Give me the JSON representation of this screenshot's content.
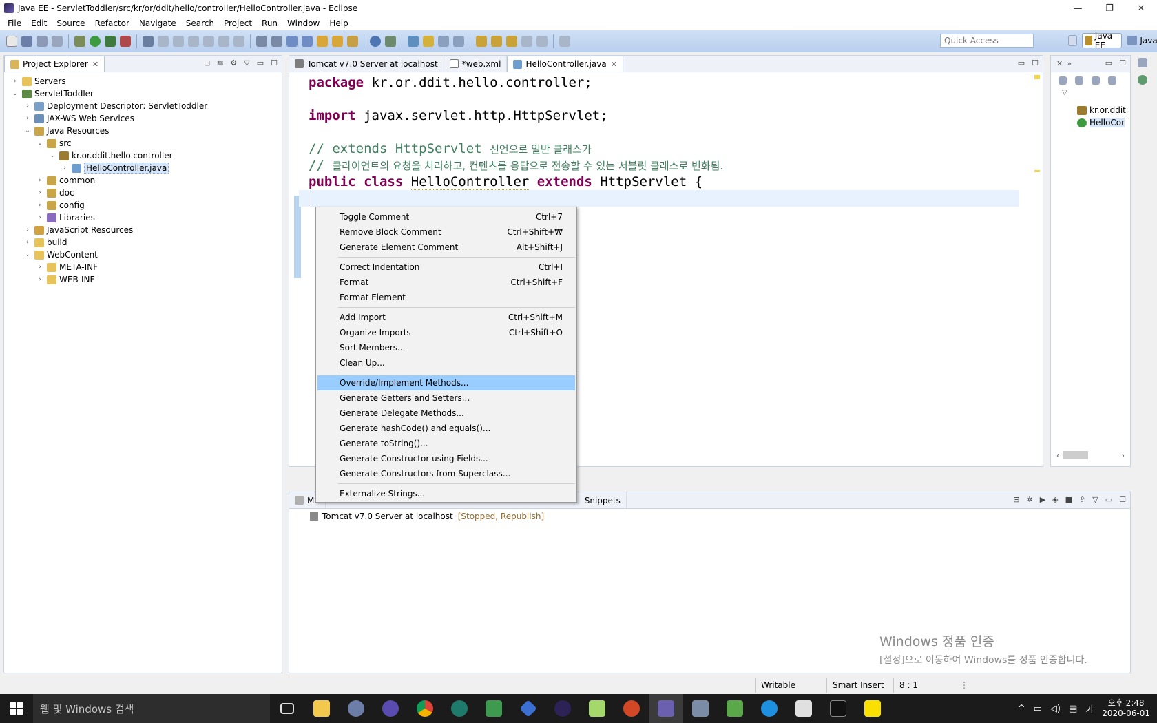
{
  "window": {
    "title": "Java EE - ServletToddler/src/kr/or/ddit/hello/controller/HelloController.java - Eclipse",
    "minimize": "—",
    "restore": "❐",
    "close": "✕"
  },
  "menubar": {
    "items": [
      {
        "label": "File"
      },
      {
        "label": "Edit"
      },
      {
        "label": "Source"
      },
      {
        "label": "Refactor"
      },
      {
        "label": "Navigate"
      },
      {
        "label": "Search"
      },
      {
        "label": "Project"
      },
      {
        "label": "Run"
      },
      {
        "label": "Window"
      },
      {
        "label": "Help"
      }
    ]
  },
  "toolbar": {
    "quick_access_placeholder": "Quick Access",
    "perspectives": [
      {
        "label": "Java EE",
        "active": true
      },
      {
        "label": "Java",
        "active": false
      }
    ]
  },
  "project_explorer": {
    "tab_label": "Project Explorer",
    "tree": [
      {
        "label": "Servers",
        "depth": 0,
        "expander": ">",
        "icon": "folder-icon"
      },
      {
        "label": "ServletToddler",
        "depth": 0,
        "expander": "v",
        "icon": "project-icon"
      },
      {
        "label": "Deployment Descriptor: ServletToddler",
        "depth": 1,
        "expander": ">",
        "icon": "deployment-descriptor-icon"
      },
      {
        "label": "JAX-WS Web Services",
        "depth": 1,
        "expander": ">",
        "icon": "web-services-icon"
      },
      {
        "label": "Java Resources",
        "depth": 1,
        "expander": "v",
        "icon": "java-resources-icon"
      },
      {
        "label": "src",
        "depth": 2,
        "expander": "v",
        "icon": "source-folder-icon"
      },
      {
        "label": "kr.or.ddit.hello.controller",
        "depth": 3,
        "expander": "v",
        "icon": "package-icon"
      },
      {
        "label": "HelloController.java",
        "depth": 4,
        "expander": ">",
        "icon": "java-file-icon",
        "selected": true
      },
      {
        "label": "common",
        "depth": 2,
        "expander": ">",
        "icon": "source-folder-icon"
      },
      {
        "label": "doc",
        "depth": 2,
        "expander": ">",
        "icon": "source-folder-icon"
      },
      {
        "label": "config",
        "depth": 2,
        "expander": ">",
        "icon": "source-folder-icon"
      },
      {
        "label": "Libraries",
        "depth": 2,
        "expander": ">",
        "icon": "library-icon"
      },
      {
        "label": "JavaScript Resources",
        "depth": 1,
        "expander": ">",
        "icon": "javascript-resources-icon"
      },
      {
        "label": "build",
        "depth": 1,
        "expander": ">",
        "icon": "folder-icon"
      },
      {
        "label": "WebContent",
        "depth": 1,
        "expander": "v",
        "icon": "folder-icon"
      },
      {
        "label": "META-INF",
        "depth": 2,
        "expander": ">",
        "icon": "folder-icon"
      },
      {
        "label": "WEB-INF",
        "depth": 2,
        "expander": ">",
        "icon": "folder-icon"
      }
    ]
  },
  "editor": {
    "tabs": [
      {
        "label": "Tomcat v7.0 Server at localhost",
        "active": false
      },
      {
        "label": "*web.xml",
        "active": false
      },
      {
        "label": "HelloController.java",
        "active": true
      }
    ],
    "code": {
      "line1_kw": "package",
      "line1_rest": " kr.or.ddit.hello.controller;",
      "line3_kw": "import",
      "line3_rest": " javax.servlet.http.HttpServlet;",
      "line5": "// extends HttpServlet ",
      "line5_kr": "선언으로 일반 클래스가",
      "line6": "// ",
      "line6_kr": "클라이언트의 요청을 처리하고, 컨텐츠를 응답으로 전송할 수 있는 서블릿 클래스로 변화됨.",
      "line7_kw1": "public",
      "line7_kw2": "class",
      "line7_name": "HelloController",
      "line7_kw3": "extends",
      "line7_rest": " HttpServlet {"
    }
  },
  "outline": {
    "items": [
      {
        "label": "kr.or.ddit"
      },
      {
        "label": "HelloCor"
      }
    ]
  },
  "context_menu": {
    "groups": [
      [
        {
          "label": "Toggle Comment",
          "shortcut": "Ctrl+7"
        },
        {
          "label": "Remove Block Comment",
          "shortcut": "Ctrl+Shift+₩"
        },
        {
          "label": "Generate Element Comment",
          "shortcut": "Alt+Shift+J"
        }
      ],
      [
        {
          "label": "Correct Indentation",
          "shortcut": "Ctrl+I"
        },
        {
          "label": "Format",
          "shortcut": "Ctrl+Shift+F"
        },
        {
          "label": "Format Element",
          "shortcut": ""
        }
      ],
      [
        {
          "label": "Add Import",
          "shortcut": "Ctrl+Shift+M"
        },
        {
          "label": "Organize Imports",
          "shortcut": "Ctrl+Shift+O"
        },
        {
          "label": "Sort Members...",
          "shortcut": ""
        },
        {
          "label": "Clean Up...",
          "shortcut": ""
        }
      ],
      [
        {
          "label": "Override/Implement Methods...",
          "shortcut": "",
          "highlighted": true
        },
        {
          "label": "Generate Getters and Setters...",
          "shortcut": ""
        },
        {
          "label": "Generate Delegate Methods...",
          "shortcut": ""
        },
        {
          "label": "Generate hashCode() and equals()...",
          "shortcut": ""
        },
        {
          "label": "Generate toString()...",
          "shortcut": ""
        },
        {
          "label": "Generate Constructor using Fields...",
          "shortcut": ""
        },
        {
          "label": "Generate Constructors from Superclass...",
          "shortcut": ""
        }
      ],
      [
        {
          "label": "Externalize Strings...",
          "shortcut": ""
        }
      ]
    ]
  },
  "bottom_views": {
    "tab_left": "Ma",
    "tab_snippets": "Snippets",
    "server_name": "Tomcat v7.0 Server at localhost",
    "server_status": "[Stopped, Republish]"
  },
  "statusbar": {
    "writable": "Writable",
    "insert_mode": "Smart Insert",
    "position": "8 : 1"
  },
  "watermark": {
    "line1": "Windows 정품 인증",
    "line2": "[설정]으로 이동하여 Windows를 정품 인증합니다."
  },
  "taskbar": {
    "search_placeholder": "웹 및 Windows 검색",
    "ime": "가",
    "time": "오후 2:48",
    "date": "2020-06-01"
  },
  "colors": {
    "keyword": "#7f0055",
    "comment": "#3f7f5f",
    "menu_highlight": "#99ccff",
    "toolbar_bg": "#c4d7f2"
  }
}
